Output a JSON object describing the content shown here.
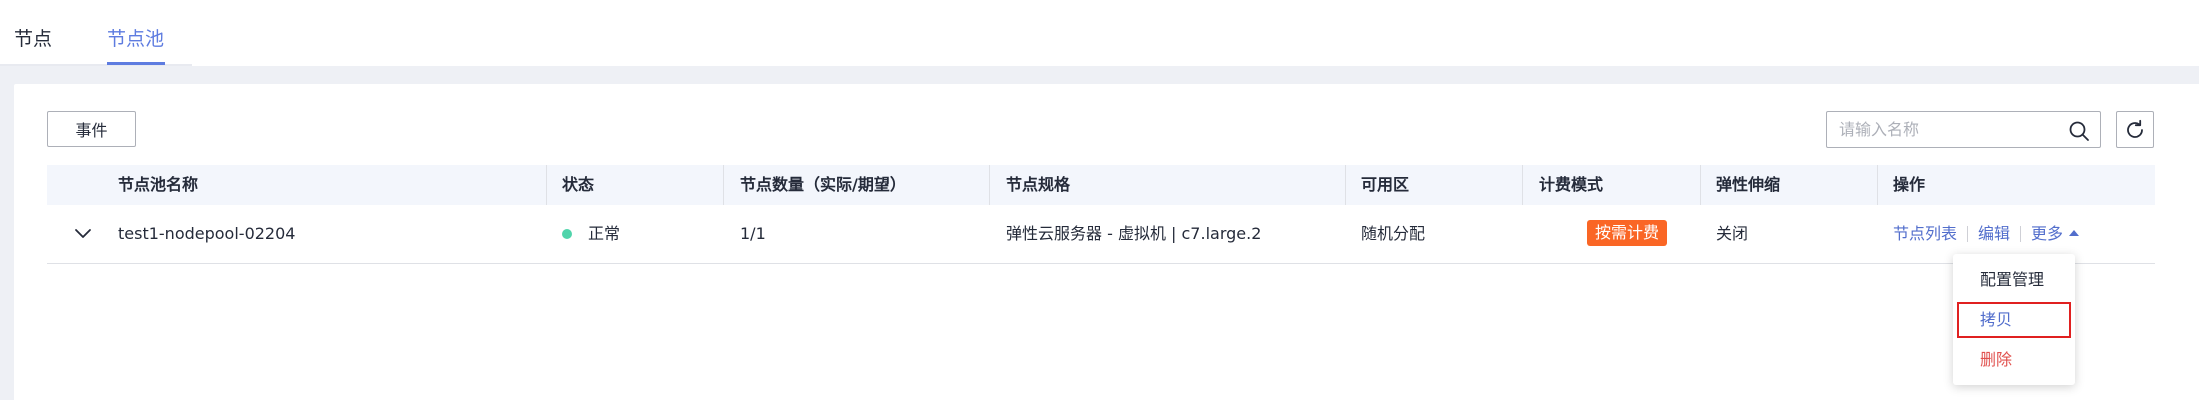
{
  "tabs": [
    {
      "label": "节点"
    },
    {
      "label": "节点池"
    }
  ],
  "toolbar": {
    "event_button": "事件",
    "search_placeholder": "请输入名称"
  },
  "table": {
    "columns": [
      "节点池名称",
      "状态",
      "节点数量（实际/期望）",
      "节点规格",
      "可用区",
      "计费模式",
      "弹性伸缩",
      "操作"
    ],
    "rows": [
      {
        "name": "test1-nodepool-02204",
        "status": "正常",
        "node_count": "1/1",
        "spec": "弹性云服务器 - 虚拟机 | c7.large.2",
        "zone": "随机分配",
        "billing": "按需计费",
        "autoscaling": "关闭",
        "actions": {
          "list": "节点列表",
          "edit": "编辑",
          "more": "更多"
        }
      }
    ]
  },
  "more_menu": {
    "items": [
      "配置管理",
      "拷贝",
      "删除"
    ],
    "highlighted": "拷贝"
  },
  "colors": {
    "accent": "#5e7ce0",
    "link": "#526ecc",
    "status_normal": "#50d4ab",
    "billing_badge": "#fa6625",
    "danger": "#e0504d",
    "highlight_box": "#e02020"
  }
}
